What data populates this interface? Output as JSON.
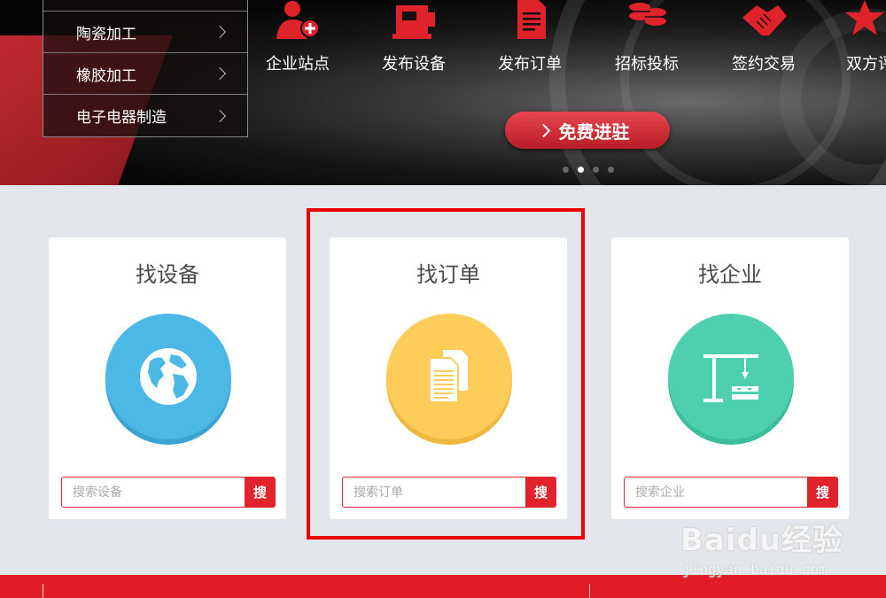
{
  "banner": {
    "categories": [
      {
        "label": ""
      },
      {
        "label": "陶瓷加工"
      },
      {
        "label": "橡胶加工"
      },
      {
        "label": "电子电器制造"
      }
    ],
    "features": [
      {
        "label": "企业站点",
        "icon": "add-user-icon"
      },
      {
        "label": "发布设备",
        "icon": "machine-icon"
      },
      {
        "label": "发布订单",
        "icon": "document-icon"
      },
      {
        "label": "招标投标",
        "icon": "coins-stack-icon"
      },
      {
        "label": "签约交易",
        "icon": "handshake-icon"
      },
      {
        "label": "双方评",
        "icon": "star-icon"
      }
    ],
    "cta_label": "免费进驻",
    "carousel": {
      "count": 4,
      "active": 2
    }
  },
  "cards": [
    {
      "title": "找设备",
      "icon": "globe-icon",
      "placeholder": "搜索设备",
      "button": "搜"
    },
    {
      "title": "找订单",
      "icon": "documents-icon",
      "placeholder": "搜索订单",
      "button": "搜"
    },
    {
      "title": "找企业",
      "icon": "crane-icon",
      "placeholder": "搜索企业",
      "button": "搜"
    }
  ],
  "watermark": {
    "main": "Baidu经验",
    "sub": "jingyan.baidu.com"
  },
  "colors": {
    "accent": "#e1232c",
    "highlight": "#ee0000",
    "blue": "#4cb8e6",
    "yellow": "#fecc58",
    "green": "#4ecfae"
  }
}
